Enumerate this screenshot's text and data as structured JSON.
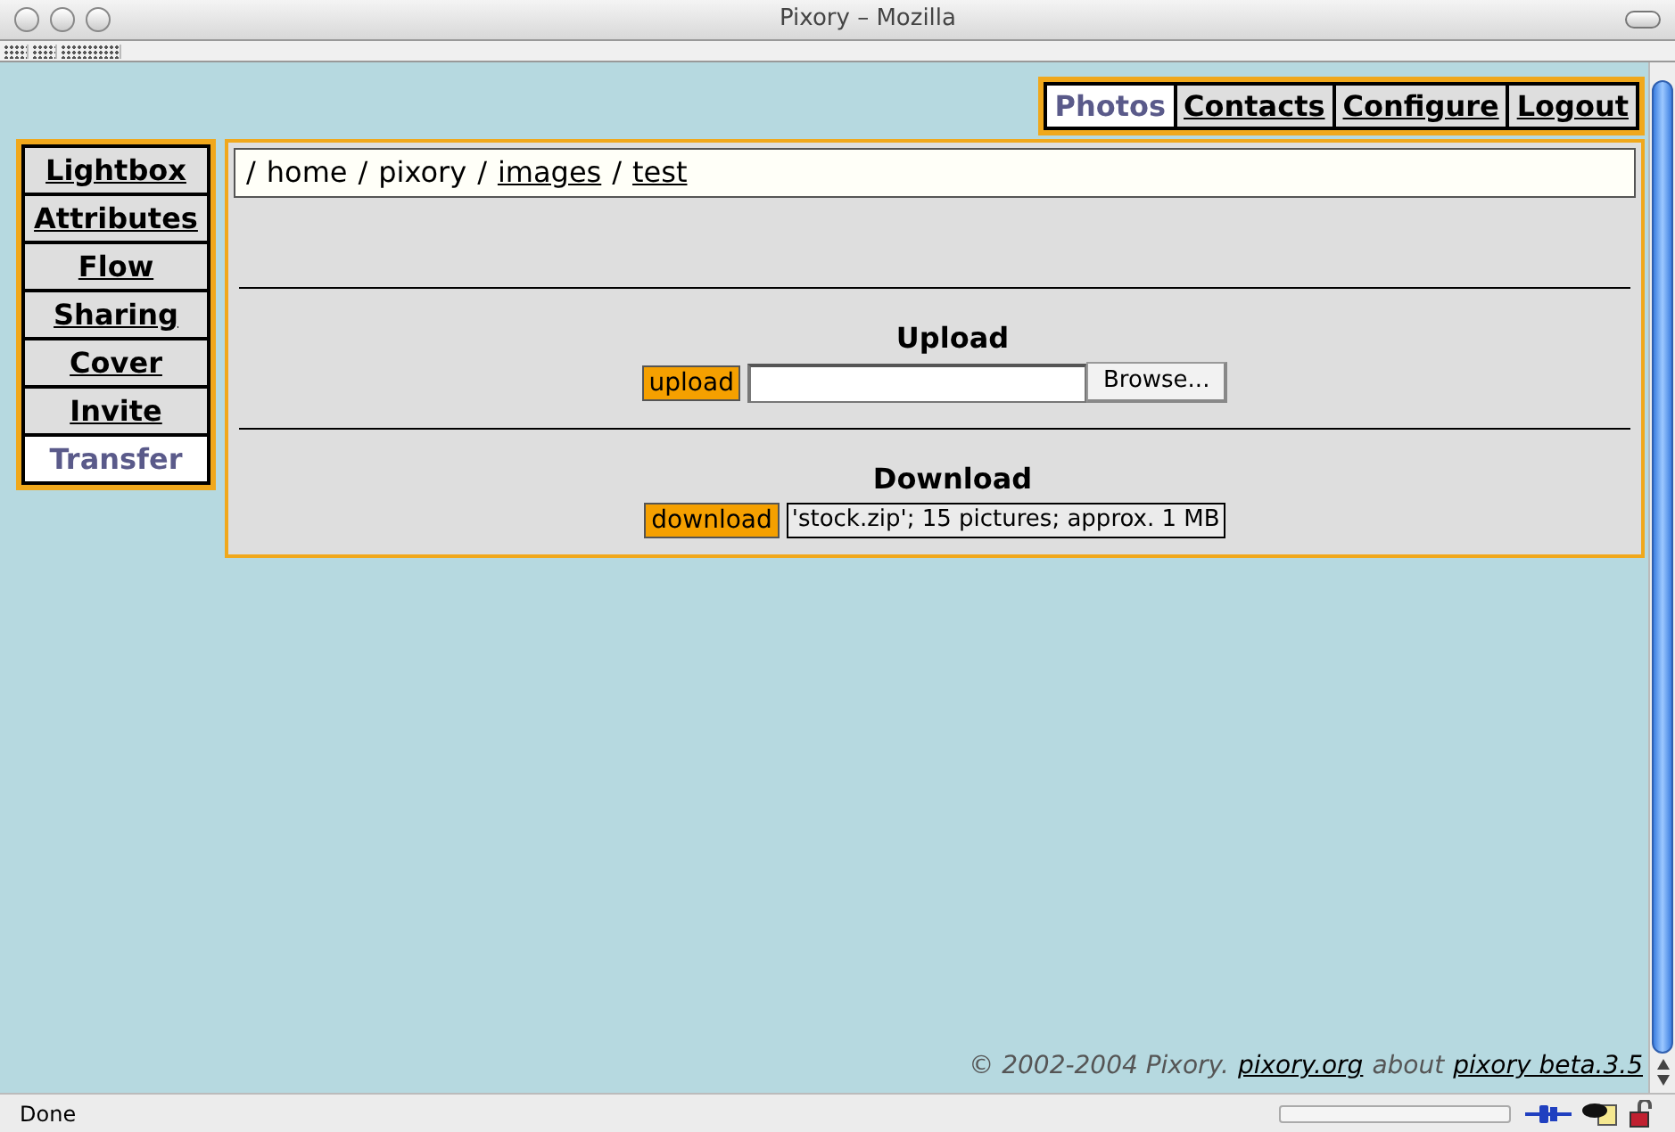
{
  "window": {
    "title": "Pixory – Mozilla"
  },
  "top_tabs": [
    {
      "label": "Photos",
      "selected": true
    },
    {
      "label": "Contacts",
      "selected": false
    },
    {
      "label": "Configure",
      "selected": false
    },
    {
      "label": "Logout",
      "selected": false
    }
  ],
  "side_tabs": [
    {
      "label": "Lightbox",
      "selected": false
    },
    {
      "label": "Attributes",
      "selected": false
    },
    {
      "label": "Flow",
      "selected": false
    },
    {
      "label": "Sharing",
      "selected": false
    },
    {
      "label": "Cover",
      "selected": false
    },
    {
      "label": "Invite",
      "selected": false
    },
    {
      "label": "Transfer",
      "selected": true
    }
  ],
  "breadcrumb": [
    {
      "text": "/",
      "link": false
    },
    {
      "text": "home",
      "link": false
    },
    {
      "text": "/",
      "link": false
    },
    {
      "text": "pixory",
      "link": false
    },
    {
      "text": "/",
      "link": false
    },
    {
      "text": "images",
      "link": true
    },
    {
      "text": "/",
      "link": false
    },
    {
      "text": "test",
      "link": true
    }
  ],
  "upload": {
    "heading": "Upload",
    "button": "upload",
    "browse": "Browse..."
  },
  "download": {
    "heading": "Download",
    "button": "download",
    "info": "'stock.zip'; 15 pictures; approx. 1 MB"
  },
  "footer": [
    {
      "text": "© 2002-2004 Pixory.",
      "link": false
    },
    {
      "text": "pixory.org",
      "link": true
    },
    {
      "text": "about",
      "link": false
    },
    {
      "text": "pixory beta.3.5",
      "link": true
    }
  ],
  "status_bar": {
    "text": "Done",
    "progress": {
      "level": 0
    }
  }
}
